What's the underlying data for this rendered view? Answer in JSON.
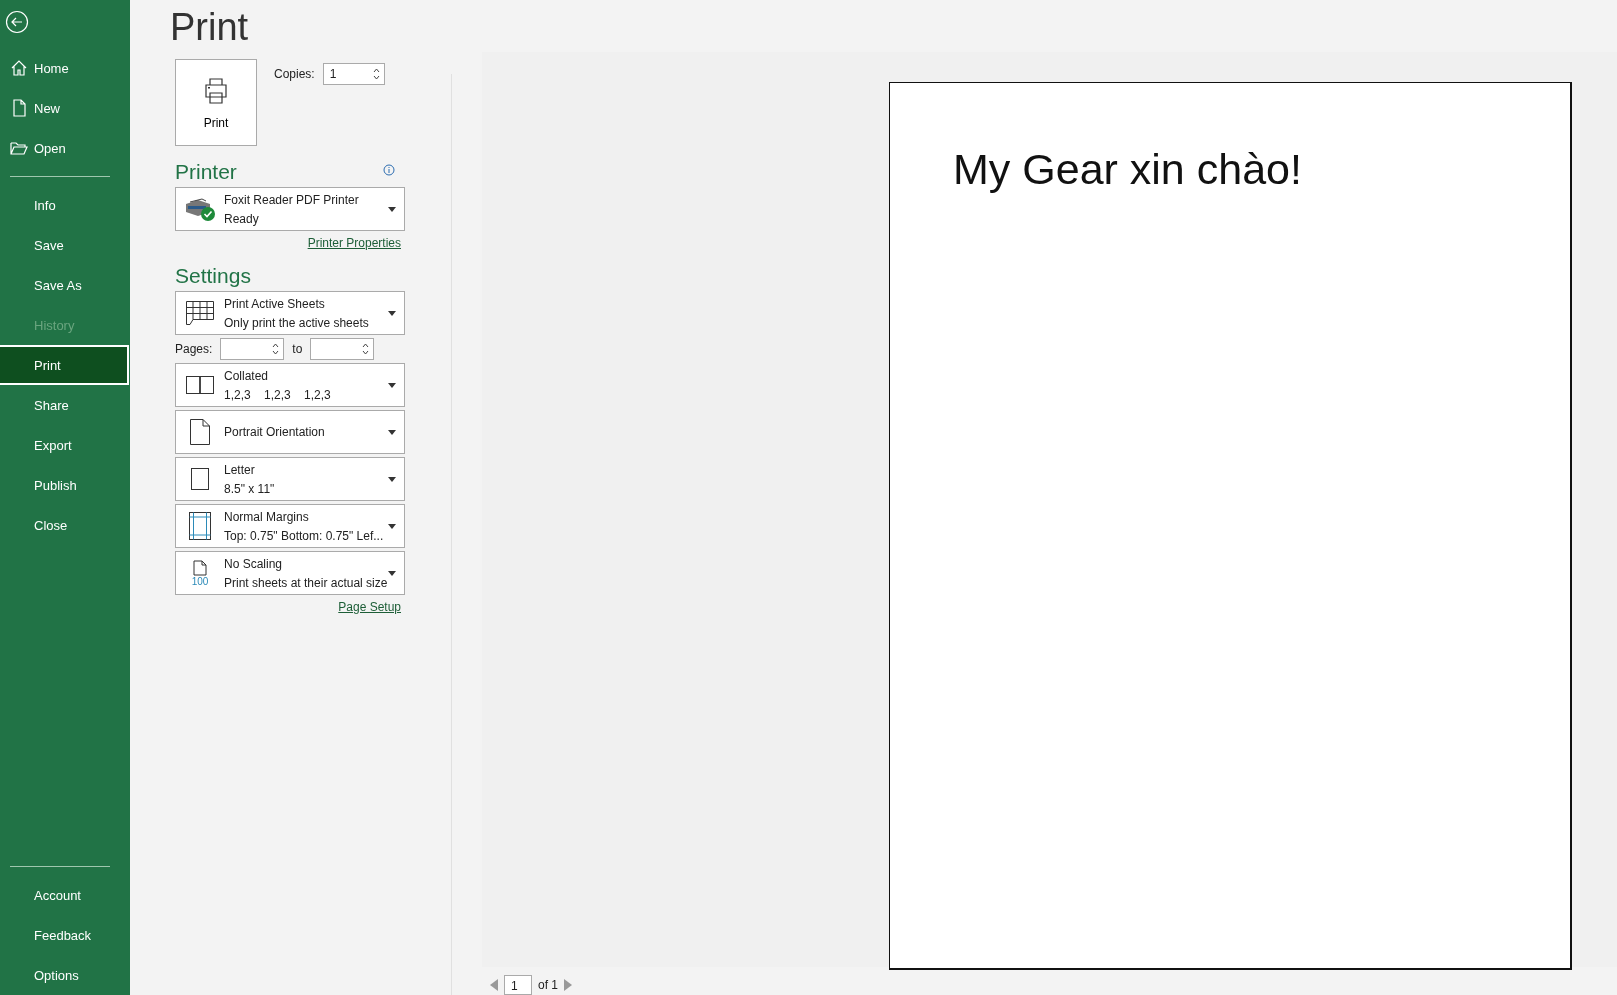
{
  "sidebar": {
    "top_items": [
      {
        "label": "Home",
        "kind": "home"
      },
      {
        "label": "New",
        "kind": "new"
      },
      {
        "label": "Open",
        "kind": "open"
      }
    ],
    "items": [
      {
        "label": "Info",
        "selected": false,
        "disabled": false
      },
      {
        "label": "Save",
        "selected": false,
        "disabled": false
      },
      {
        "label": "Save As",
        "selected": false,
        "disabled": false
      },
      {
        "label": "History",
        "selected": false,
        "disabled": true
      },
      {
        "label": "Print",
        "selected": true,
        "disabled": false
      },
      {
        "label": "Share",
        "selected": false,
        "disabled": false
      },
      {
        "label": "Export",
        "selected": false,
        "disabled": false
      },
      {
        "label": "Publish",
        "selected": false,
        "disabled": false
      },
      {
        "label": "Close",
        "selected": false,
        "disabled": false
      }
    ],
    "bottom_items": [
      {
        "label": "Account"
      },
      {
        "label": "Feedback"
      },
      {
        "label": "Options"
      }
    ]
  },
  "page_title": "Print",
  "print_button": {
    "label": "Print"
  },
  "copies": {
    "label": "Copies:",
    "value": "1"
  },
  "printer": {
    "heading": "Printer",
    "name": "Foxit Reader PDF Printer",
    "status": "Ready",
    "properties_link": "Printer Properties"
  },
  "settings": {
    "heading": "Settings",
    "dropdowns": [
      {
        "kind": "sheets",
        "line1": "Print Active Sheets",
        "line2": "Only print the active sheets"
      },
      {
        "kind": "pages"
      },
      {
        "kind": "collated",
        "line1": "Collated",
        "line2": "1,2,3    1,2,3    1,2,3"
      },
      {
        "kind": "orientation",
        "line1": "Portrait Orientation"
      },
      {
        "kind": "paper",
        "line1": "Letter",
        "line2": "8.5\" x 11\""
      },
      {
        "kind": "margins",
        "line1": "Normal Margins",
        "line2": "Top: 0.75\" Bottom: 0.75\" Lef..."
      },
      {
        "kind": "scaling",
        "line1": "No Scaling",
        "line2": "Print sheets at their actual size",
        "icon_text": "100"
      }
    ],
    "pages": {
      "label": "Pages:",
      "to_label": "to"
    },
    "page_setup_link": "Page Setup"
  },
  "preview": {
    "text": "My Gear xin chào!",
    "page_field": "1",
    "page_total": "of 1"
  }
}
